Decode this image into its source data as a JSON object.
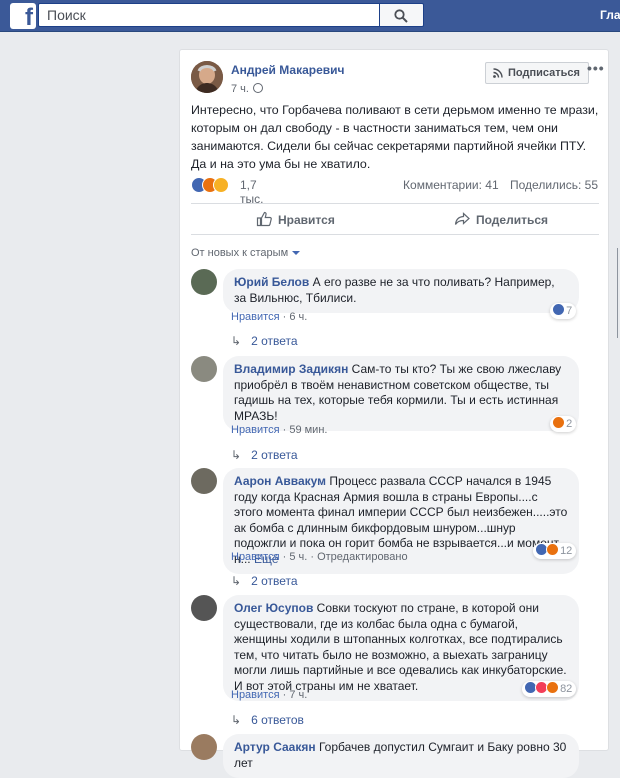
{
  "topbar": {
    "logo": "f",
    "search_placeholder": "Поиск",
    "home_label": "Гла"
  },
  "post": {
    "author": "Андрей Макаревич",
    "time": "7 ч.",
    "subscribe_label": "Подписаться",
    "more_label": "•••",
    "text": "Интересно, что Горбачева поливают в сети дерьмом именно те мрази, которым он дал свободу - в частности заниматься тем, чем они занимаются. Сидели бы сейчас секретарями партийной ячейки ПТУ. Да и на это ума бы не хватило.",
    "reaction_count": "1,7 тыс.",
    "comments_count": "Комментарии: 41",
    "shares_count": "Поделились: 55",
    "like_label": "Нравится",
    "share_label": "Поделиться",
    "sort_label": "От новых к старым"
  },
  "comments": [
    {
      "name": "Юрий Белов",
      "text": "А его разве не за что поливать? Например, за Вильнюс, Тбилиси.",
      "like": "Нравится",
      "time": "6 ч.",
      "edited": "",
      "reactions": "7",
      "replies": "2 ответа"
    },
    {
      "name": "Владимир Задикян",
      "text": "Сам-то ты кто? Ты же свою лжеславу приобрёл в твоём ненавистном советском обществе, ты гадишь на тех, которые тебя кормили. Ты и есть истинная МРАЗЬ!",
      "like": "Нравится",
      "time": "59 мин.",
      "edited": "",
      "reactions": "2",
      "replies": "2 ответа"
    },
    {
      "name": "Аарон Аввакум",
      "text": "Процесс развала СССР начался в 1945 году когда Красная Армия вошла в страны Европы....с этого момента финал империи СССР был неизбежен.....это ак бомба с длинным бикфордовым шнуром...шнур подожгли и пока он горит бомба не взрывается...и момент н...",
      "more": "Ещё",
      "like": "Нравится",
      "time": "5 ч.",
      "edited": "Отредактировано",
      "reactions": "12",
      "replies": "2 ответа"
    },
    {
      "name": "Олег Юсупов",
      "text": "Совки тоскуют по стране, в которой они существовали, где из колбас была одна с бумагой, женщины ходили в штопанных колготках, все подтирались тем, что читать было не возможно, а выехать заграницу могли лишь партийные и все одевались как инкубаторские.",
      "text2": "И вот этой страны им не хватает.",
      "like": "Нравится",
      "time": "7 ч.",
      "edited": "",
      "reactions": "82",
      "replies": "6 ответов"
    },
    {
      "name": "Артур Саакян",
      "text": "Горбачев допустил Сумгаит и Баку ровно 30 лет"
    }
  ],
  "colors": {
    "brand": "#3b5998",
    "link": "#385898",
    "bubble": "#f2f3f5"
  }
}
